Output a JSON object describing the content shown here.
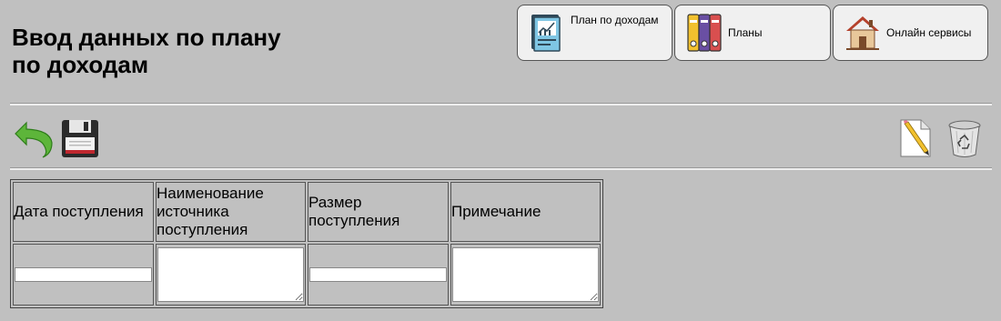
{
  "page_title": "Ввод данных по плану по доходам",
  "nav": {
    "income_plan": {
      "label": "План по доходам",
      "icon": "report-chart-icon"
    },
    "plans": {
      "label": "Планы",
      "icon": "binders-icon"
    },
    "online_services": {
      "label": "Онлайн сервисы",
      "icon": "house-icon"
    }
  },
  "toolbar": {
    "back_icon": "undo-arrow-icon",
    "save_icon": "floppy-disk-icon",
    "edit_icon": "edit-document-icon",
    "delete_icon": "recycle-bin-icon"
  },
  "table": {
    "headers": [
      "Дата поступления",
      "Наименование источника поступления",
      "Размер поступления",
      "Примечание"
    ],
    "inputs": {
      "date": "",
      "source": "",
      "amount": "",
      "note": ""
    }
  },
  "colors": {
    "background": "#c0c0c0",
    "button_bg": "#f0f0f0",
    "undo_green": "#5db53a",
    "floppy_dark": "#2b2b2b",
    "floppy_red": "#c0282f"
  }
}
